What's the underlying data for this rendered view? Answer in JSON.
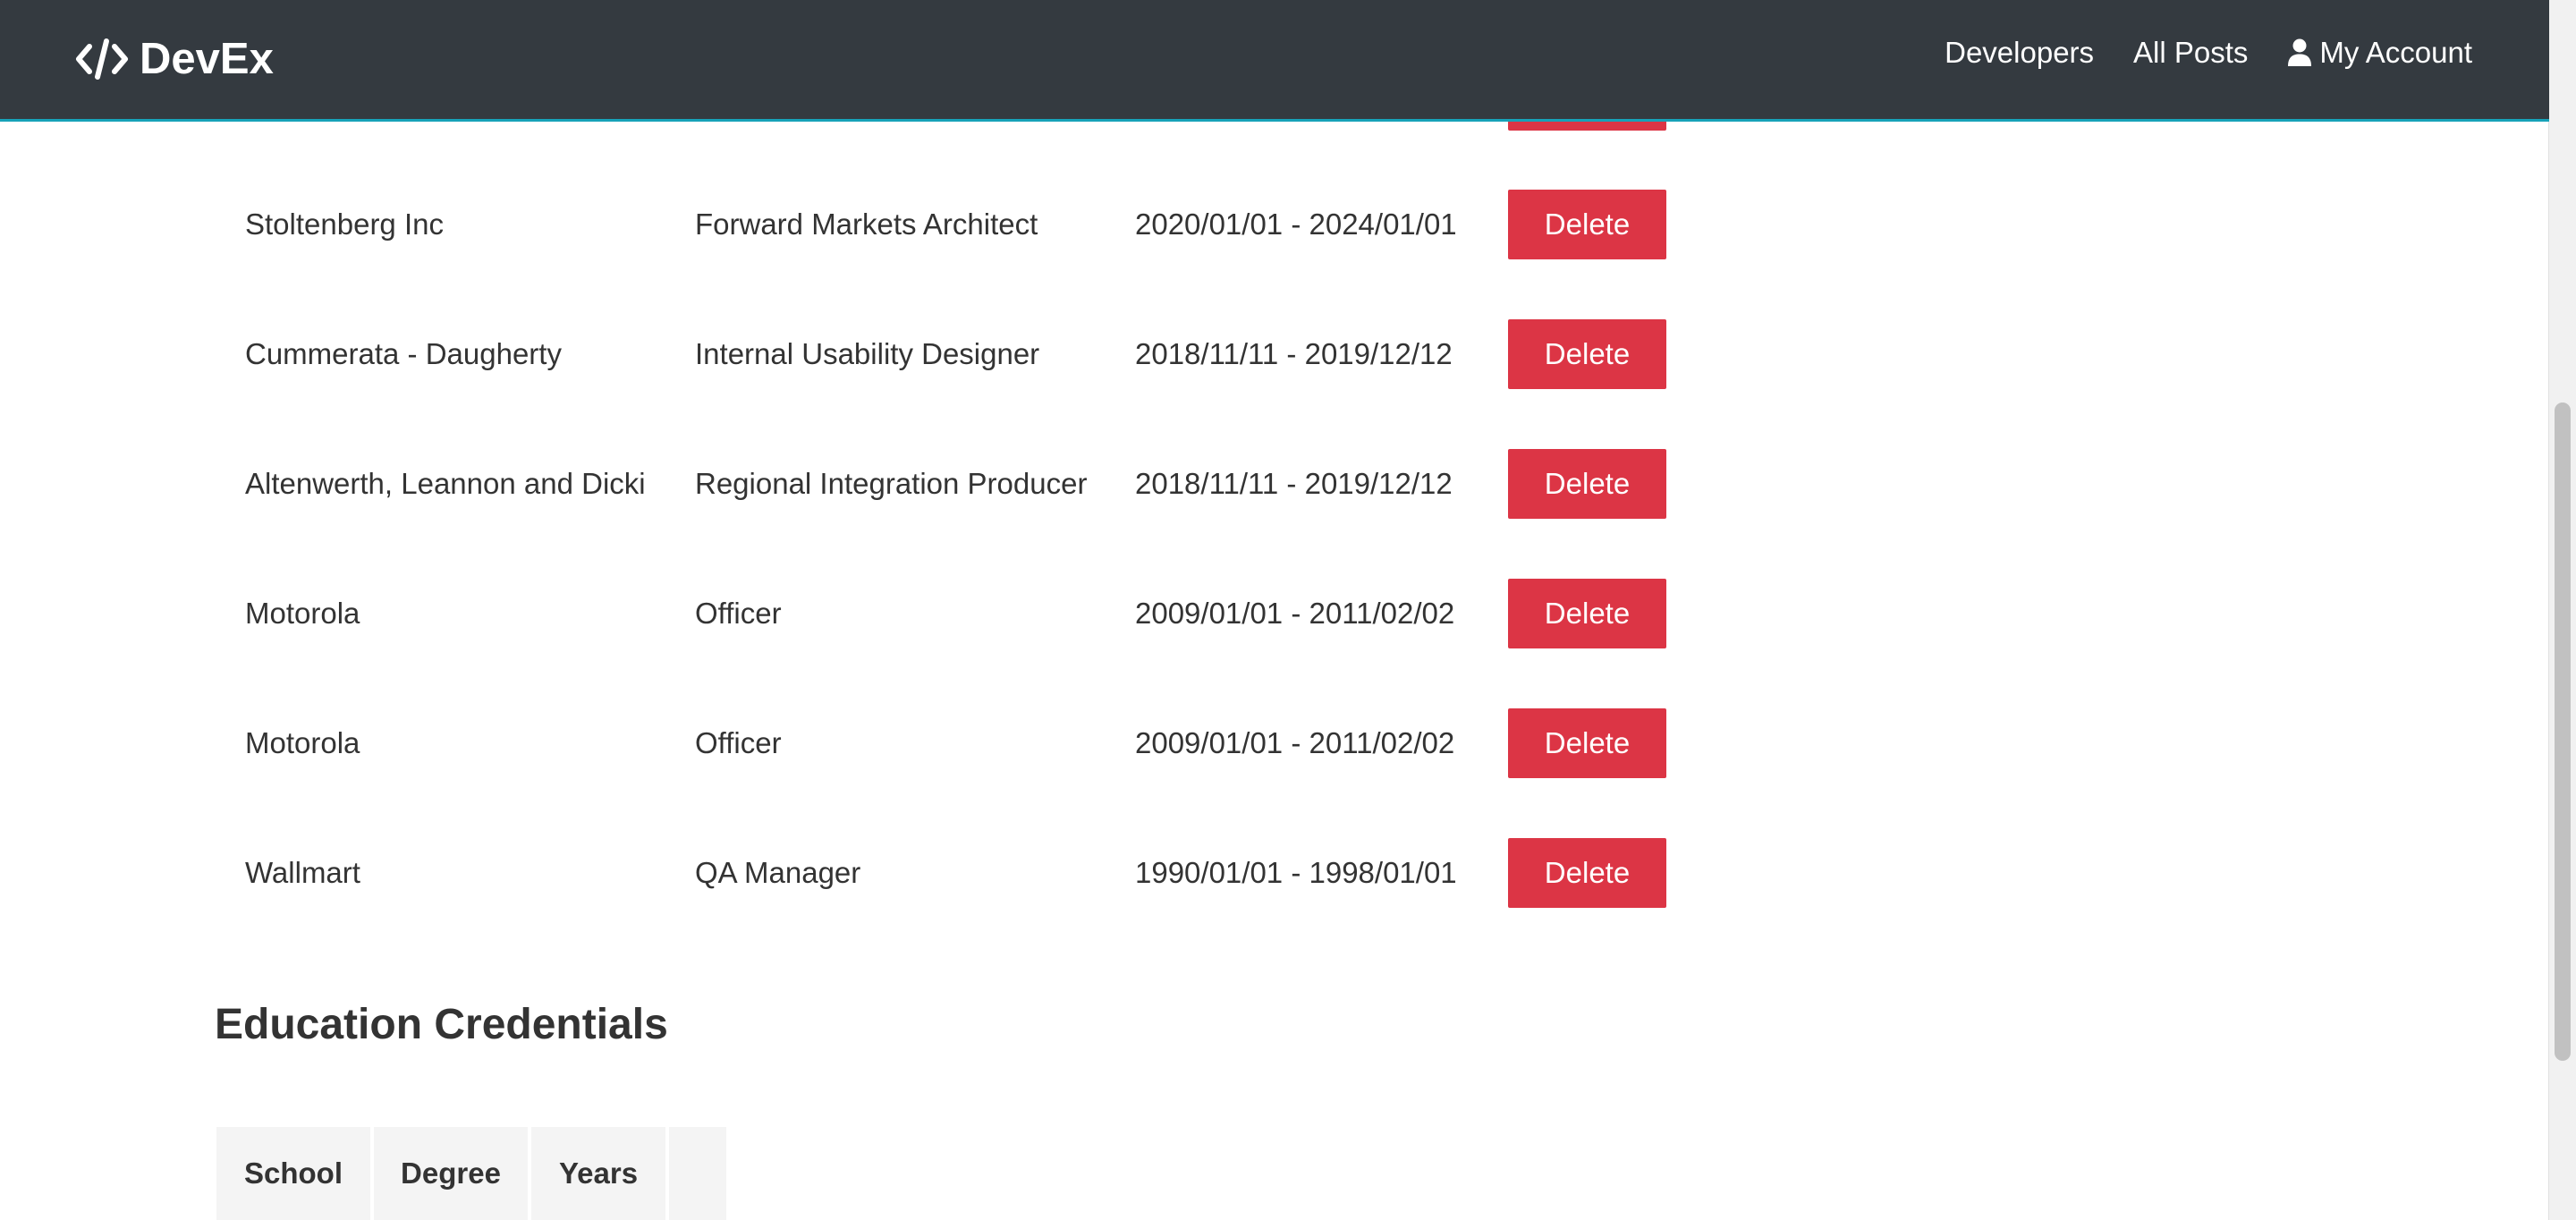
{
  "navbar": {
    "brand": "DevEx",
    "links": [
      "Developers",
      "All Posts",
      "My Account"
    ]
  },
  "experience": {
    "rows": [
      {
        "company": "Stoltenberg Inc",
        "title": "Forward Markets Architect",
        "years": "2020/01/01 - 2024/01/01",
        "action": "Delete"
      },
      {
        "company": "Cummerata - Daugherty",
        "title": "Internal Usability Designer",
        "years": "2018/11/11 - 2019/12/12",
        "action": "Delete"
      },
      {
        "company": "Altenwerth, Leannon and Dicki",
        "title": "Regional Integration Producer",
        "years": "2018/11/11 - 2019/12/12",
        "action": "Delete"
      },
      {
        "company": "Motorola",
        "title": "Officer",
        "years": "2009/01/01 - 2011/02/02",
        "action": "Delete"
      },
      {
        "company": "Motorola",
        "title": "Officer",
        "years": "2009/01/01 - 2011/02/02",
        "action": "Delete"
      },
      {
        "company": "Wallmart",
        "title": "QA Manager",
        "years": "1990/01/01 - 1998/01/01",
        "action": "Delete"
      }
    ]
  },
  "education": {
    "title": "Education Credentials",
    "headers": [
      "School",
      "Degree",
      "Years",
      ""
    ]
  },
  "colors": {
    "navbar": "#343a40",
    "accent": "#17a2b8",
    "danger": "#dc3545"
  },
  "icons": {
    "brand": "code-icon",
    "account": "user-icon"
  }
}
